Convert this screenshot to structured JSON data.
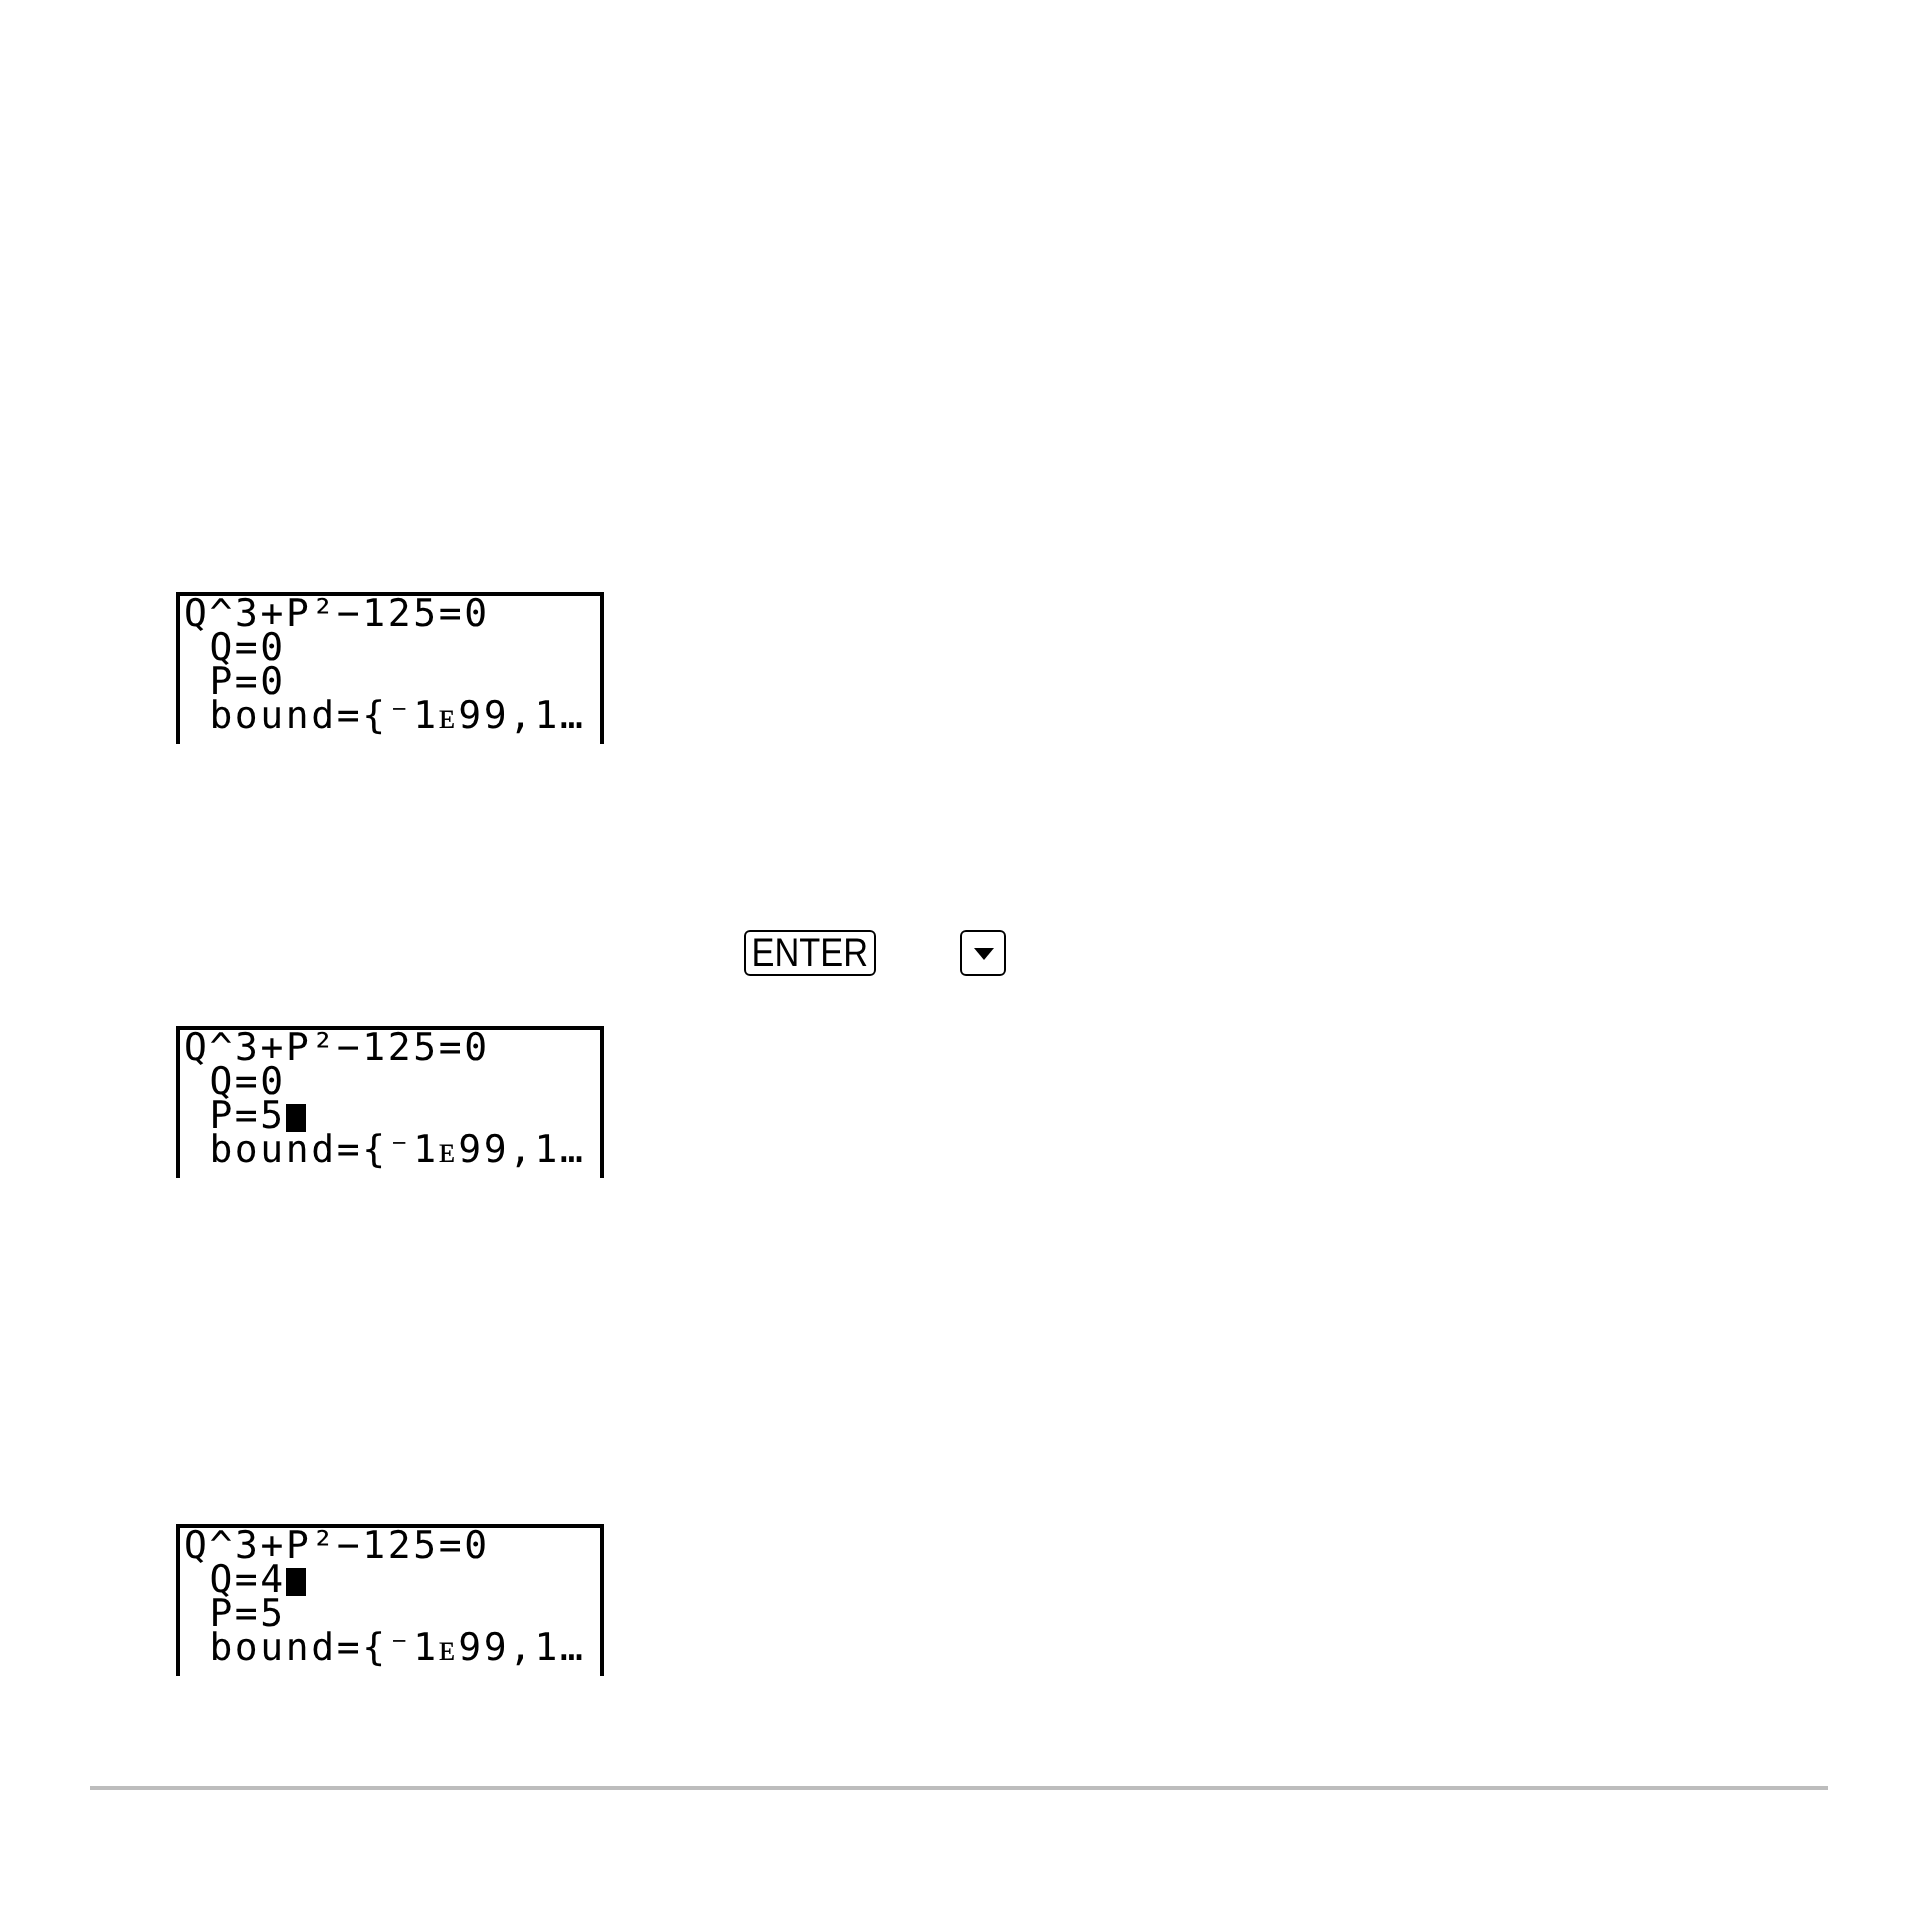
{
  "sections": [
    {
      "kind": "screen",
      "lines": [
        {
          "kind": "equation",
          "text": "Q^3+P²−125=0",
          "cursor": false
        },
        {
          "kind": "variable",
          "text": "Q=0",
          "cursor": false
        },
        {
          "kind": "variable",
          "text": "P=0",
          "cursor": false
        },
        {
          "kind": "variable",
          "text": "bound={⁻1ᴇ99,1…",
          "cursor": false
        }
      ]
    },
    {
      "kind": "keys",
      "keys": [
        {
          "kind": "label",
          "label": "ENTER"
        },
        {
          "kind": "down"
        }
      ]
    },
    {
      "kind": "screen",
      "lines": [
        {
          "kind": "equation",
          "text": "Q^3+P²−125=0",
          "cursor": false
        },
        {
          "kind": "variable",
          "text": "Q=0",
          "cursor": false
        },
        {
          "kind": "variable",
          "text": "P=5",
          "cursor": true
        },
        {
          "kind": "variable",
          "text": "bound={⁻1ᴇ99,1…",
          "cursor": false
        }
      ]
    },
    {
      "kind": "screen",
      "lines": [
        {
          "kind": "equation",
          "text": "Q^3+P²−125=0",
          "cursor": false
        },
        {
          "kind": "variable",
          "text": "Q=4",
          "cursor": true
        },
        {
          "kind": "variable",
          "text": "P=5",
          "cursor": false
        },
        {
          "kind": "variable",
          "text": "bound={⁻1ᴇ99,1…",
          "cursor": false
        }
      ]
    }
  ]
}
